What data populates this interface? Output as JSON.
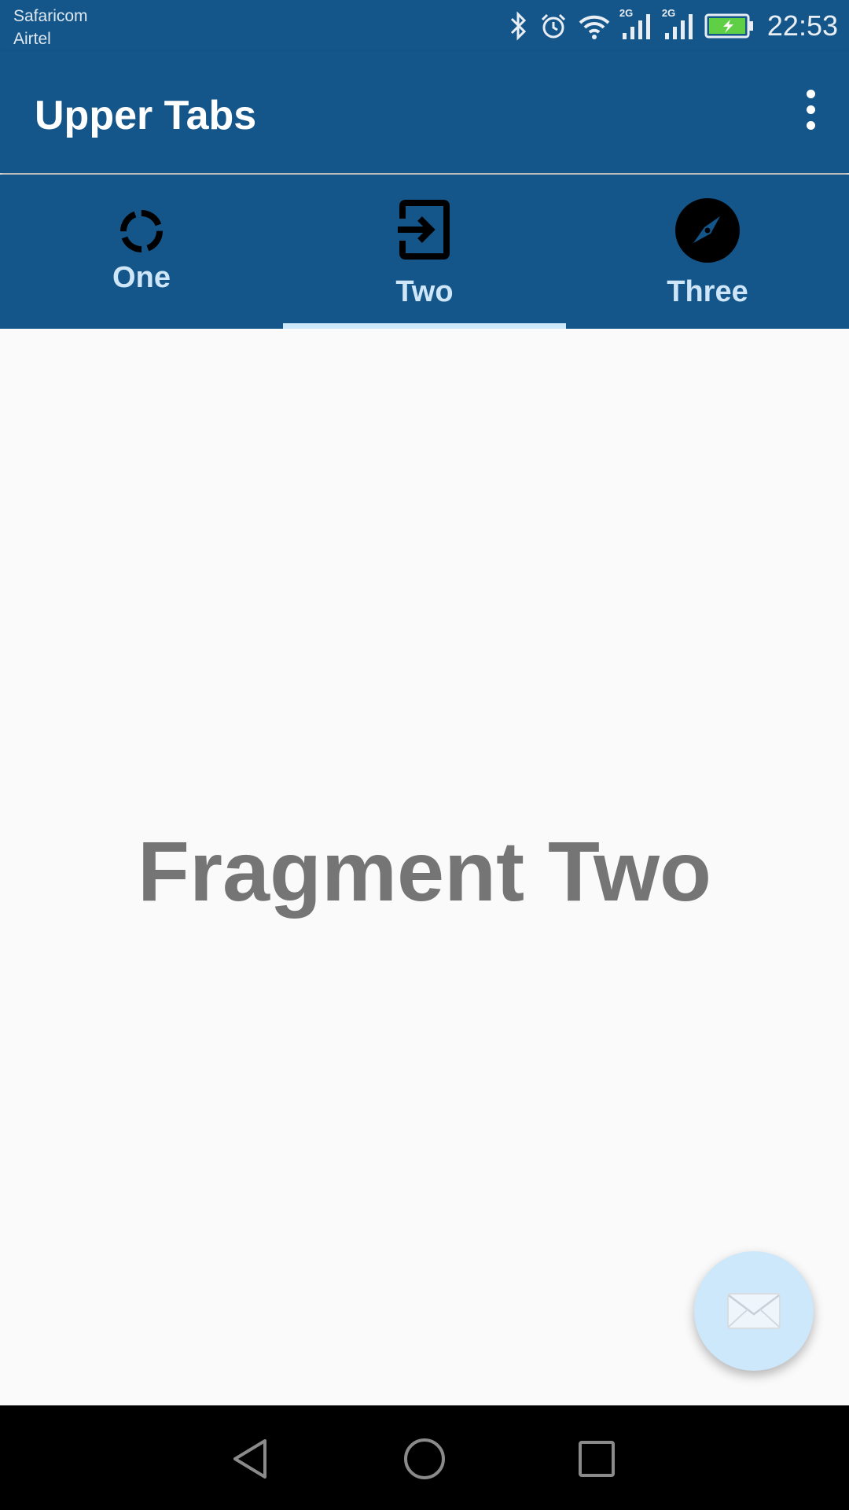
{
  "status_bar": {
    "carrier_1": "Safaricom",
    "carrier_2": "Airtel",
    "signal_1_tag": "2G",
    "signal_2_tag": "2G",
    "time": "22:53",
    "icons": [
      "bluetooth-icon",
      "alarm-icon",
      "wifi-icon",
      "signal-icon",
      "signal-icon",
      "battery-charging-icon"
    ]
  },
  "app_bar": {
    "title": "Upper Tabs",
    "menu_icon": "more-vert-icon"
  },
  "tabs": [
    {
      "label": "One",
      "icon": "loading-ring-icon",
      "selected": false
    },
    {
      "label": "Two",
      "icon": "exit-to-app-icon",
      "selected": true
    },
    {
      "label": "Three",
      "icon": "compass-icon",
      "selected": false
    }
  ],
  "content": {
    "text": "Fragment Two"
  },
  "fab": {
    "icon": "mail-icon"
  },
  "nav_bar": {
    "icons": [
      "back-icon",
      "home-icon",
      "recents-icon"
    ]
  },
  "colors": {
    "primary": "#14568a",
    "tab_label": "#cfe6f8",
    "indicator": "#cde7fb",
    "fab": "#cde7fb",
    "content_text": "#757575",
    "background": "#fafafa"
  }
}
